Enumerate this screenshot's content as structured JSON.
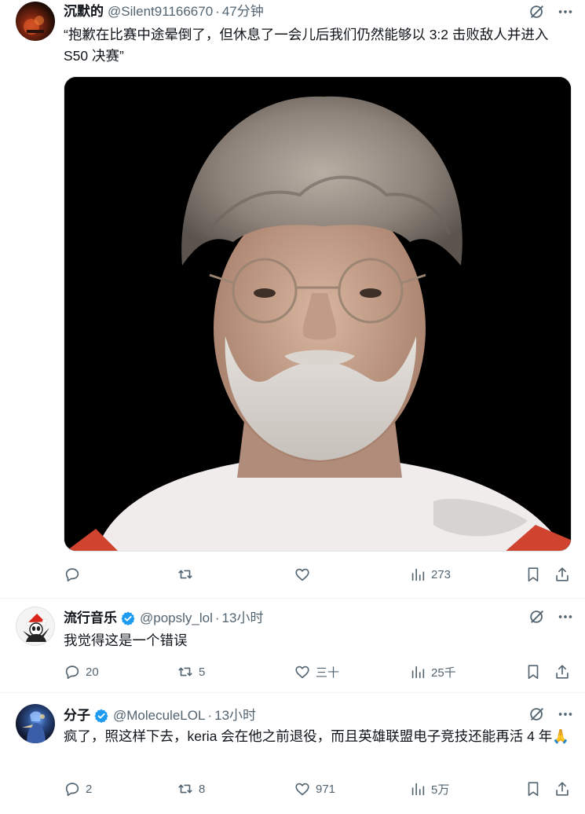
{
  "tweets": [
    {
      "name": "沉默的",
      "handle": "@Silent91166670",
      "time": "47分钟",
      "text": "“抱歉在比赛中途晕倒了，但休息了一会儿后我们仍然能够以 3:2 击败敌人并进入 S50 决赛”",
      "replies": "",
      "retweets": "",
      "likes": "",
      "views": "273"
    },
    {
      "name": "流行音乐",
      "handle": "@popsly_lol",
      "time": "13小时",
      "text": "我觉得这是一个错误",
      "replies": "20",
      "retweets": "5",
      "likes": "三十",
      "views": "25千"
    },
    {
      "name": "分子",
      "handle": "@MoleculeLOL",
      "time": "13小时",
      "text": "疯了，照这样下去，keria 会在他之前退役，而且英雄联盟电子竞技还能再活 4 年🙏",
      "replies": "2",
      "retweets": "8",
      "likes": "971",
      "views": "5万"
    }
  ],
  "icons": {
    "verified": "verified-badge-icon",
    "grok": "grok-icon",
    "more": "more-icon",
    "reply": "reply-icon",
    "retweet": "retweet-icon",
    "like": "like-icon",
    "views": "views-icon",
    "bookmark": "bookmark-icon",
    "share": "share-icon"
  },
  "colors": {
    "text_primary": "#0f1419",
    "text_secondary": "#536471",
    "verified": "#1d9bf0",
    "divider": "#eff3f4"
  }
}
